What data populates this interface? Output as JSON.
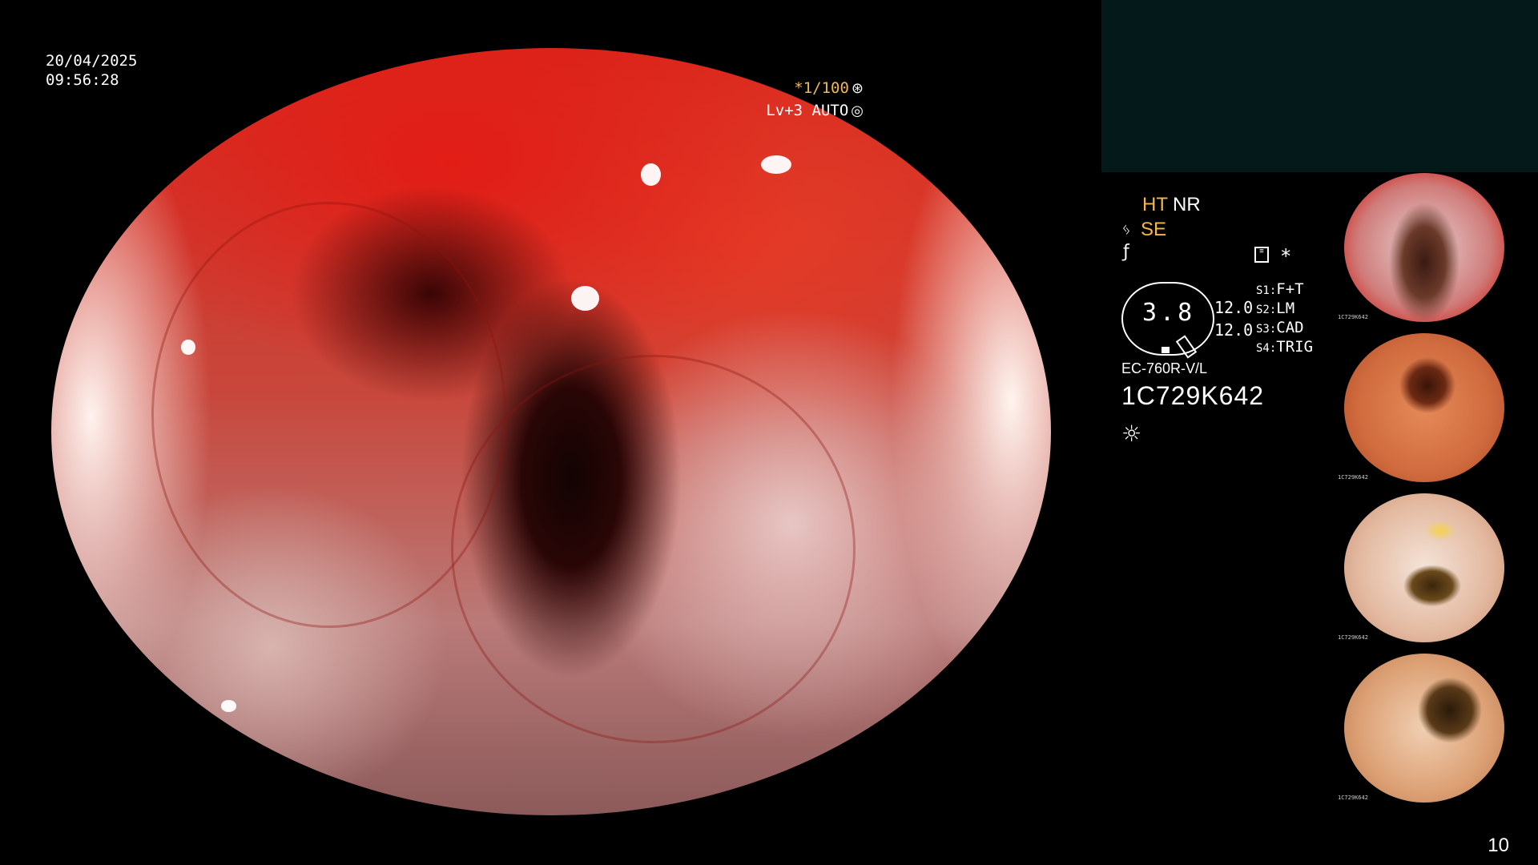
{
  "datetime": {
    "date": "20/04/2025",
    "time": "09:56:28"
  },
  "overlay": {
    "shutter": "*1/100",
    "shutter_icon": "aperture-icon",
    "level": "Lv+3 AUTO",
    "level_icon": "iris-icon"
  },
  "status": {
    "ht": "HT",
    "nr": "NR",
    "se": "SE",
    "zoom_value": "3.8",
    "zoom_line1": "12.0",
    "zoom_line2": "12.0",
    "switches": [
      {
        "key": "S1:",
        "value": "F+T"
      },
      {
        "key": "S2:",
        "value": "LM"
      },
      {
        "key": "S3:",
        "value": "CAD"
      },
      {
        "key": "S4:",
        "value": "TRIG"
      }
    ],
    "scope_model": "EC-760R-V/L",
    "serial": "1C729K642",
    "star": "*"
  },
  "thumbnails": [
    {
      "serial": "1C729K642"
    },
    {
      "serial": "1C729K642"
    },
    {
      "serial": "1C729K642"
    },
    {
      "serial": "1C729K642"
    }
  ],
  "page_number": "10",
  "colors": {
    "accent": "#f3b84d",
    "panel": "#03191a",
    "background": "#000000"
  }
}
